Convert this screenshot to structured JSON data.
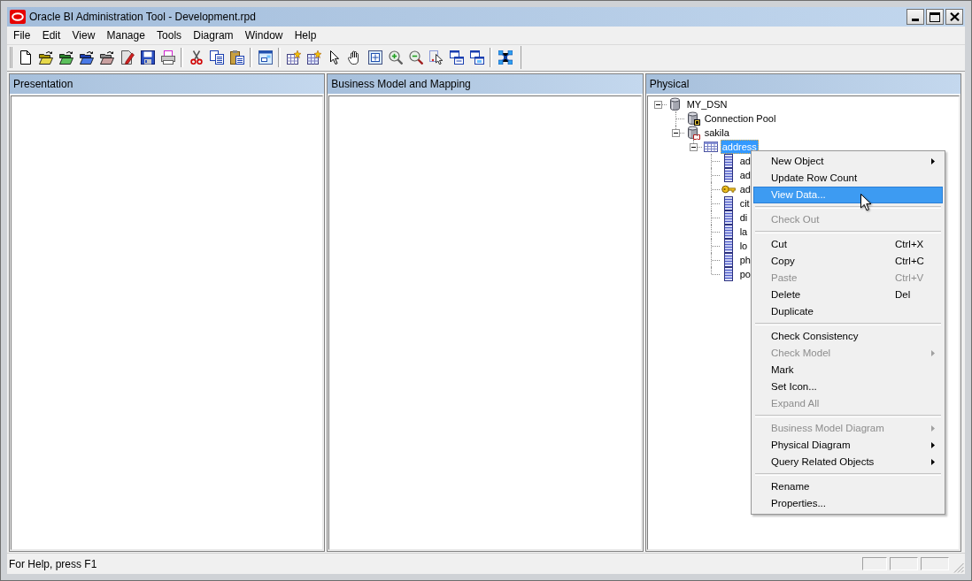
{
  "window": {
    "title": "Oracle BI Administration Tool - Development.rpd"
  },
  "menu_bar": [
    "File",
    "Edit",
    "View",
    "Manage",
    "Tools",
    "Diagram",
    "Window",
    "Help"
  ],
  "panes": [
    {
      "title": "Presentation"
    },
    {
      "title": "Business Model and Mapping"
    },
    {
      "title": "Physical",
      "tree": [
        {
          "label": "MY_DSN",
          "kind": "database",
          "expanded": true,
          "selected": false,
          "children": [
            {
              "label": "Connection Pool",
              "kind": "connection_pool",
              "selected": false
            },
            {
              "label": "sakila",
              "kind": "schema",
              "expanded": true,
              "selected": false,
              "children": [
                {
                  "label": "address",
                  "kind": "table",
                  "expanded": true,
                  "selected": true,
                  "children": [
                    {
                      "label": "ad",
                      "kind": "column",
                      "selected": false
                    },
                    {
                      "label": "ad",
                      "kind": "column",
                      "selected": false
                    },
                    {
                      "label": "ad",
                      "kind": "key",
                      "selected": false
                    },
                    {
                      "label": "cit",
                      "kind": "column",
                      "selected": false
                    },
                    {
                      "label": "di",
                      "kind": "column",
                      "selected": false
                    },
                    {
                      "label": "la",
                      "kind": "column",
                      "selected": false
                    },
                    {
                      "label": "lo",
                      "kind": "column",
                      "selected": false
                    },
                    {
                      "label": "ph",
                      "kind": "column",
                      "selected": false
                    },
                    {
                      "label": "po",
                      "kind": "column",
                      "selected": false
                    }
                  ]
                }
              ]
            }
          ]
        }
      ]
    }
  ],
  "context_menu": {
    "items": [
      {
        "kind": "command",
        "label": "New Object",
        "submenu": true,
        "disabled": false,
        "selected": false
      },
      {
        "kind": "command",
        "label": "Update Row Count",
        "submenu": false,
        "disabled": false,
        "selected": false
      },
      {
        "kind": "command",
        "label": "View Data...",
        "submenu": false,
        "disabled": false,
        "selected": true
      },
      {
        "kind": "separator"
      },
      {
        "kind": "command",
        "label": "Check Out",
        "submenu": false,
        "disabled": true,
        "selected": false
      },
      {
        "kind": "separator"
      },
      {
        "kind": "command",
        "label": "Cut",
        "shortcut": "Ctrl+X",
        "submenu": false,
        "disabled": false,
        "selected": false
      },
      {
        "kind": "command",
        "label": "Copy",
        "shortcut": "Ctrl+C",
        "submenu": false,
        "disabled": false,
        "selected": false
      },
      {
        "kind": "command",
        "label": "Paste",
        "shortcut": "Ctrl+V",
        "submenu": false,
        "disabled": true,
        "selected": false
      },
      {
        "kind": "command",
        "label": "Delete",
        "shortcut": "Del",
        "submenu": false,
        "disabled": false,
        "selected": false
      },
      {
        "kind": "command",
        "label": "Duplicate",
        "submenu": false,
        "disabled": false,
        "selected": false
      },
      {
        "kind": "separator"
      },
      {
        "kind": "command",
        "label": "Check Consistency",
        "submenu": false,
        "disabled": false,
        "selected": false
      },
      {
        "kind": "command",
        "label": "Check Model",
        "submenu": true,
        "disabled": true,
        "selected": false
      },
      {
        "kind": "command",
        "label": "Mark",
        "submenu": false,
        "disabled": false,
        "selected": false
      },
      {
        "kind": "command",
        "label": "Set Icon...",
        "submenu": false,
        "disabled": false,
        "selected": false
      },
      {
        "kind": "command",
        "label": "Expand All",
        "submenu": false,
        "disabled": true,
        "selected": false
      },
      {
        "kind": "separator"
      },
      {
        "kind": "command",
        "label": "Business Model Diagram",
        "submenu": true,
        "disabled": true,
        "selected": false
      },
      {
        "kind": "command",
        "label": "Physical Diagram",
        "submenu": true,
        "disabled": false,
        "selected": false
      },
      {
        "kind": "command",
        "label": "Query Related Objects",
        "submenu": true,
        "disabled": false,
        "selected": false
      },
      {
        "kind": "separator"
      },
      {
        "kind": "command",
        "label": "Rename",
        "submenu": false,
        "disabled": false,
        "selected": false
      },
      {
        "kind": "command",
        "label": "Properties...",
        "submenu": false,
        "disabled": false,
        "selected": false
      }
    ]
  },
  "status_bar": {
    "text": "For Help, press F1"
  }
}
